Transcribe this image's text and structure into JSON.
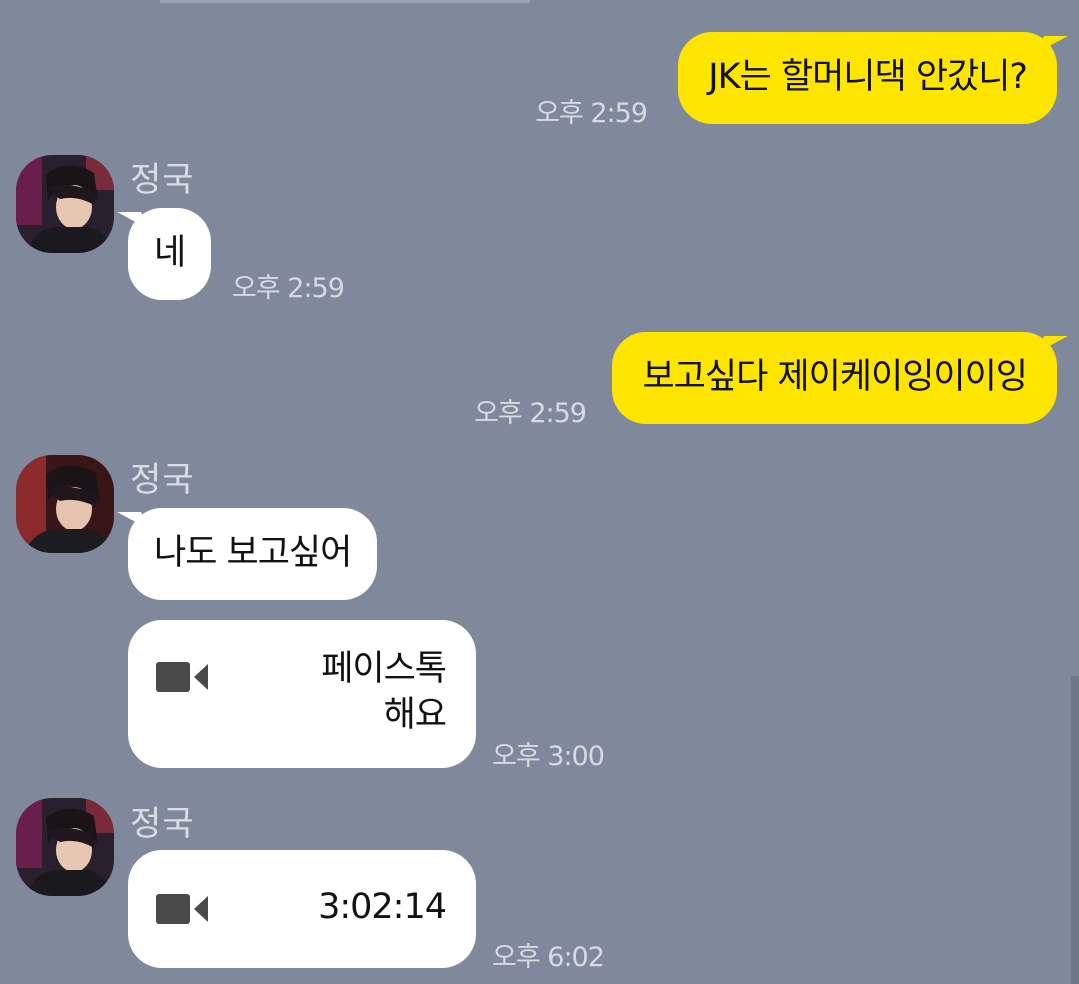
{
  "sender_name": "정국",
  "messages": {
    "m1": {
      "text": "JK는 할머니댁 안갔니?",
      "time": "오후 2:59"
    },
    "m2": {
      "text": "네",
      "time": "오후 2:59"
    },
    "m3": {
      "text": "보고싶다 제이케이잉이이잉",
      "time": "오후 2:59"
    },
    "m4": {
      "text": "나도 보고싶어"
    },
    "m5": {
      "line1": "페이스톡",
      "line2": "해요",
      "time": "오후 3:00"
    },
    "m6": {
      "text": "3:02:14",
      "time": "오후 6:02"
    }
  },
  "icons": {
    "call": "video-camera-icon"
  },
  "colors": {
    "background": "#7f899b",
    "my_bubble": "#fee500",
    "their_bubble": "#ffffff",
    "timestamp": "#d5dae3"
  }
}
